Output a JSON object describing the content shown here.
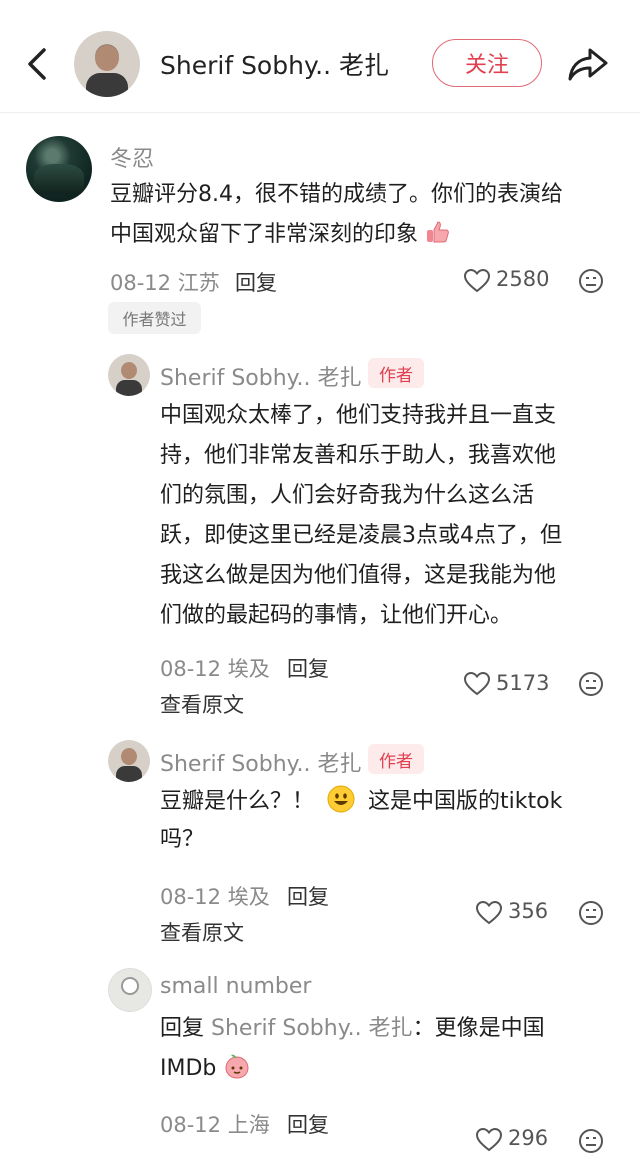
{
  "header": {
    "title": "Sherif Sobhy.. 老扎",
    "follow_label": "关注"
  },
  "comments": [
    {
      "user": "冬忍",
      "text_line1": "豆瓣评分8.4，很不错的成绩了。你们的表演给",
      "text_line2": "中国观众留下了非常深刻的印象",
      "date_loc": "08-12 江苏",
      "reply_label": "回复",
      "likes": "2580",
      "badge": "作者赞过"
    },
    {
      "user": "Sherif Sobhy.. 老扎",
      "tag": "作者",
      "lines": [
        "中国观众太棒了，他们支持我并且一直支",
        "持，他们非常友善和乐于助人，我喜欢他",
        "们的氛围，人们会好奇我为什么这么活",
        "跃，即使这里已经是凌晨3点或4点了，但",
        "我这么做是因为他们值得，这是我能为他",
        "们做的最起码的事情，让他们开心。"
      ],
      "date_loc": "08-12 埃及",
      "reply_label": "回复",
      "view_original": "查看原文",
      "likes": "5173"
    },
    {
      "user": "Sherif Sobhy.. 老扎",
      "tag": "作者",
      "text_line1_a": "豆瓣是什么？！",
      "text_line1_b": "这是中国版的tiktok",
      "text_line2": "吗？",
      "date_loc": "08-12 埃及",
      "reply_label": "回复",
      "view_original": "查看原文",
      "likes": "356"
    },
    {
      "user": "small number",
      "reply_prefix": "回复",
      "mention": "Sherif Sobhy.. 老扎",
      "text_line1": "：更像是中国",
      "text_line2": "IMDb",
      "date_loc": "08-12 上海",
      "reply_label": "回复",
      "likes": "296"
    }
  ],
  "colors": {
    "accent": "#e0404f",
    "muted": "#8a8a8a"
  }
}
